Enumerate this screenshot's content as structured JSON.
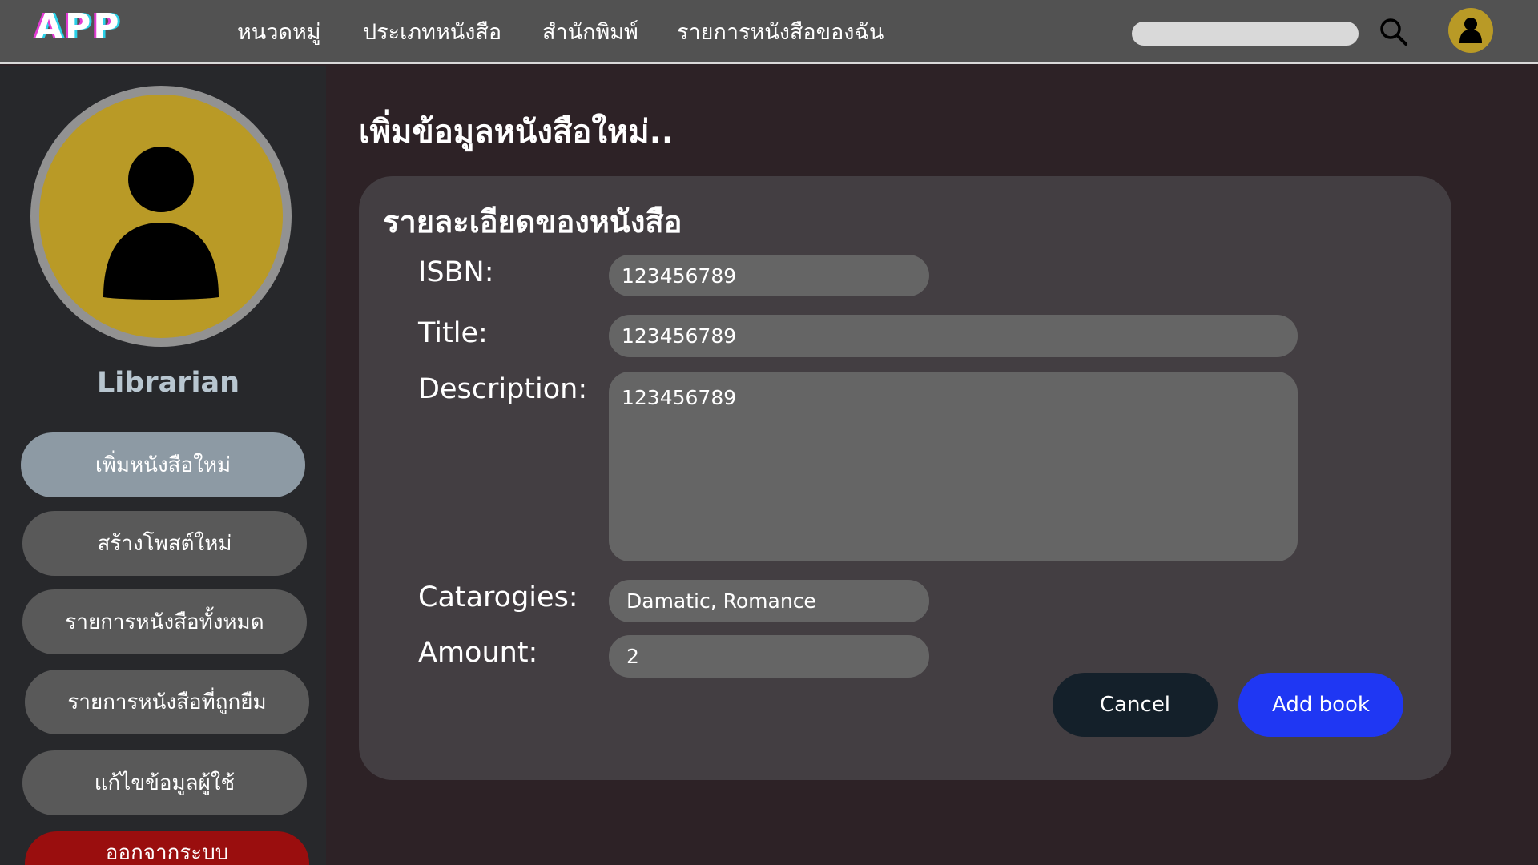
{
  "header": {
    "logo": "APP",
    "nav": [
      {
        "label": "หนวดหมู่"
      },
      {
        "label": "ประเภทหนังสือ"
      },
      {
        "label": "สำนักพิมพ์"
      },
      {
        "label": "รายการหนังสือของฉัน"
      }
    ],
    "search": {
      "value": "",
      "placeholder": ""
    },
    "icons": {
      "search": "search-icon",
      "avatar": "user-icon"
    }
  },
  "sidebar": {
    "role": "Librarian",
    "items": [
      {
        "label": "เพิ่มหนังสือใหม่",
        "active": true
      },
      {
        "label": "สร้างโพสต์ใหม่"
      },
      {
        "label": "รายการหนังสือทั้งหมด"
      },
      {
        "label": "รายการหนังสือที่ถูกยืม"
      },
      {
        "label": "แก้ไขข้อมูลผู้ใช้"
      },
      {
        "label": "ออกจากระบบ"
      }
    ]
  },
  "main": {
    "title": "เพิ่มข้อมูลหนังสือใหม่..",
    "card_title": "รายละเอียดของหนังสือ",
    "fields": {
      "isbn": {
        "label": "ISBN:",
        "value": "123456789"
      },
      "title": {
        "label": "Title:",
        "value": "123456789"
      },
      "description": {
        "label": "Description:",
        "value": "123456789"
      },
      "categories": {
        "label": "Catarogies:",
        "value": "Damatic, Romance"
      },
      "amount": {
        "label": "Amount:",
        "value": "2"
      }
    },
    "cancel_label": "Cancel",
    "add_label": "Add book"
  },
  "colors": {
    "topbar": "#525252",
    "background": "#2d2226",
    "sidebar": "#27282b",
    "avatar": "#b99a26",
    "active_item": "#8d9aa4",
    "logout": "#9a0e0e",
    "card": "#433e42",
    "field": "#656565",
    "cancel": "#14202a",
    "primary": "#1f37f3"
  }
}
